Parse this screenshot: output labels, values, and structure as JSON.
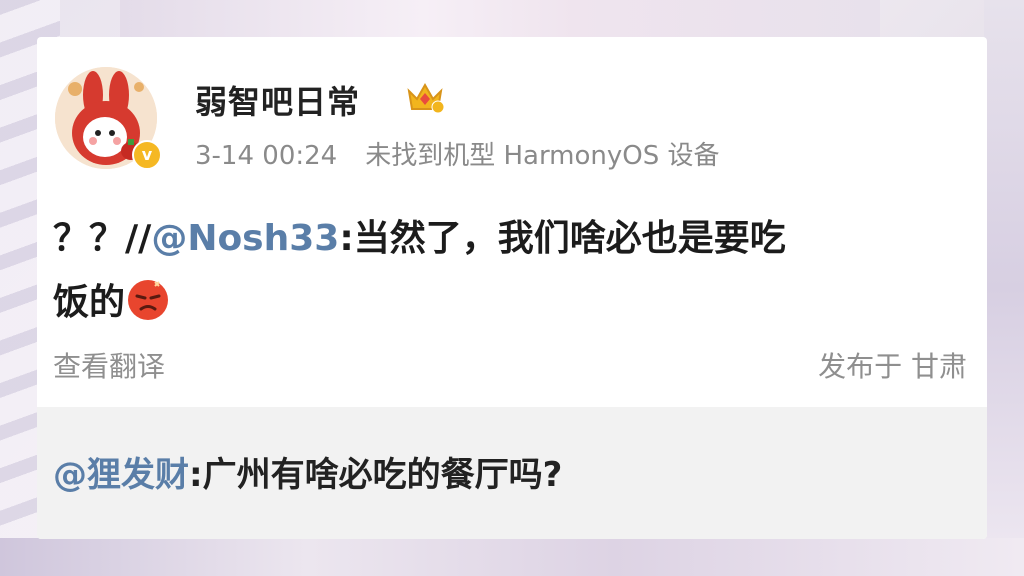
{
  "post": {
    "username": "弱智吧日常",
    "date": "3-14 00:24",
    "device": "未找到机型 HarmonyOS 设备",
    "prefix": "？？//",
    "mention": "@Nosh33",
    "colon": ":",
    "body_line1": "当然了，我们啥必也是要吃",
    "body_line2": "饭的",
    "emoji": "angry-face-emoji",
    "translate_label": "查看翻译",
    "location": "发布于 甘肃"
  },
  "quote": {
    "mention": "@狸发财",
    "colon": ":",
    "text": "广州有啥必吃的餐厅吗?"
  },
  "icons": {
    "avatar": "cartoon-rabbit-avatar",
    "verified": "verified-badge-icon",
    "crown": "crown-badge-icon"
  },
  "colors": {
    "mention": "#5a7ea8",
    "secondary_text": "#8f8f8f",
    "verified": "#f5b823",
    "quote_bg": "#f2f2f2"
  }
}
